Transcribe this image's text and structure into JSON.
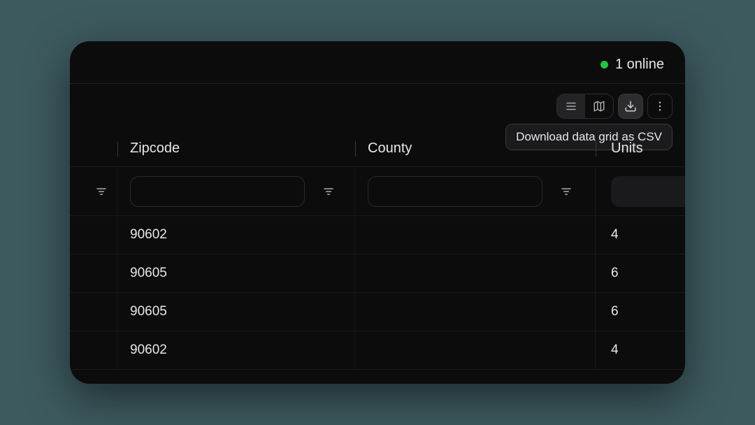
{
  "status": {
    "online_text": "1 online"
  },
  "toolbar": {
    "tooltip_download": "Download data grid as CSV"
  },
  "grid": {
    "columns": {
      "zipcode": "Zipcode",
      "county": "County",
      "units": "Units"
    },
    "rows": [
      {
        "zipcode": "90602",
        "county": "",
        "units": "4"
      },
      {
        "zipcode": "90605",
        "county": "",
        "units": "6"
      },
      {
        "zipcode": "90605",
        "county": "",
        "units": "6"
      },
      {
        "zipcode": "90602",
        "county": "",
        "units": "4"
      }
    ]
  }
}
